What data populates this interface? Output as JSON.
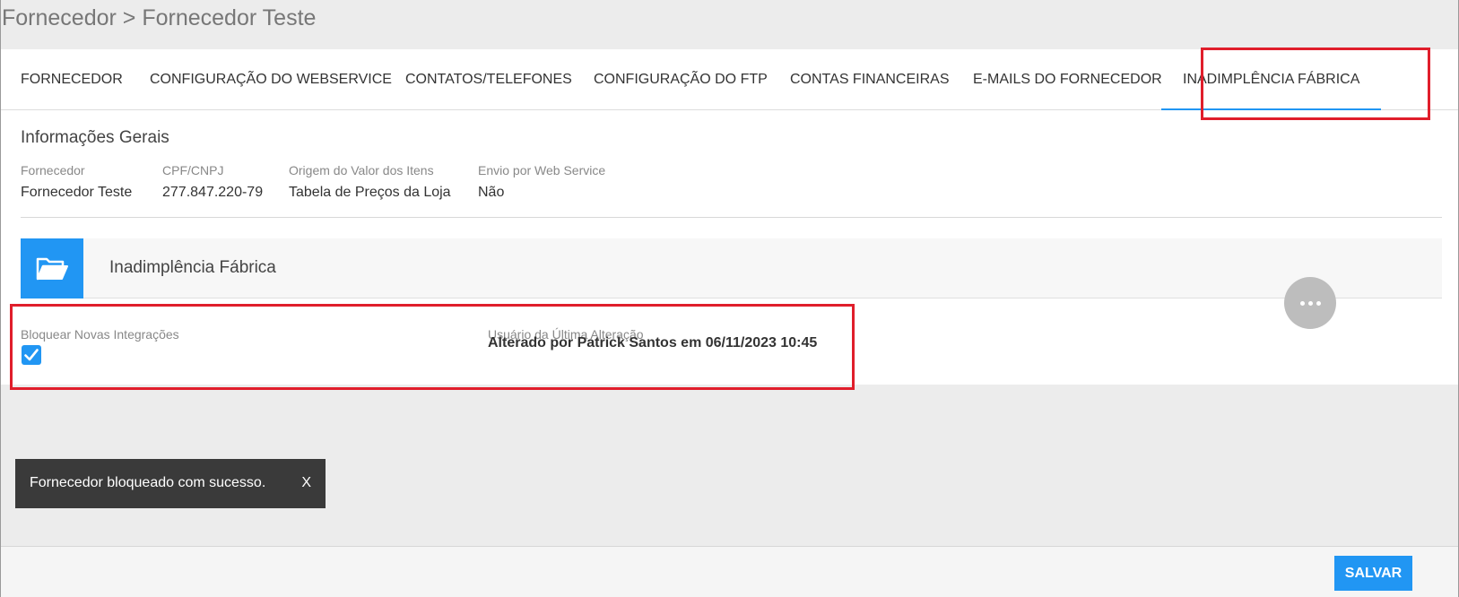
{
  "breadcrumb": "Fornecedor > Fornecedor Teste",
  "tabs": [
    {
      "label": "FORNECEDOR"
    },
    {
      "label": "CONFIGURAÇÃO DO WEBSERVICE"
    },
    {
      "label": "CONTATOS/TELEFONES"
    },
    {
      "label": "CONFIGURAÇÃO DO FTP"
    },
    {
      "label": "CONTAS FINANCEIRAS"
    },
    {
      "label": "E-MAILS DO FORNECEDOR"
    },
    {
      "label": "INADIMPLÊNCIA FÁBRICA",
      "active": true
    }
  ],
  "general_info": {
    "title": "Informações Gerais",
    "fields": [
      {
        "label": "Fornecedor",
        "value": "Fornecedor Teste"
      },
      {
        "label": "CPF/CNPJ",
        "value": "277.847.220-79"
      },
      {
        "label": "Origem do Valor dos Itens",
        "value": "Tabela de Preços da Loja"
      },
      {
        "label": "Envio por Web Service",
        "value": "Não"
      }
    ]
  },
  "panel": {
    "title": "Inadimplência Fábrica",
    "icon": "folder-open-icon",
    "block_label": "Bloquear Novas Integrações",
    "block_checked": true,
    "last_user_label": "Usuário da Última Alteração",
    "last_user_value": "Alterado por Patrick Santos em 06/11/2023 10:45"
  },
  "toast": {
    "message": "Fornecedor bloqueado com sucesso.",
    "close_label": "X"
  },
  "footer": {
    "save_label": "SALVAR"
  },
  "colors": {
    "accent": "#2196f3",
    "highlight": "#e01e2b",
    "toast_bg": "#3a3a3a"
  }
}
